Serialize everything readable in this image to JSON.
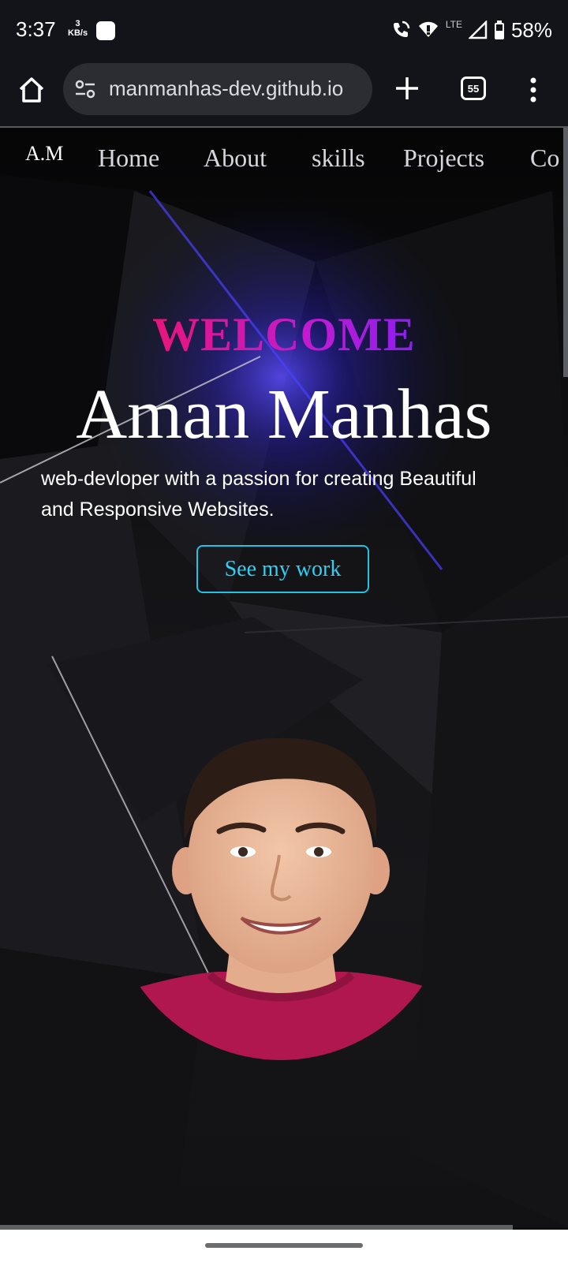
{
  "status_bar": {
    "time": "3:37",
    "net_speed_value": "3",
    "net_speed_unit": "KB/s",
    "battery": "58%",
    "network": "LTE",
    "icons": [
      "wifi-calling-icon",
      "wifi-icon",
      "signal-icon",
      "battery-icon"
    ]
  },
  "browser": {
    "url": "manmanhas-dev.github.io",
    "tab_count": "55",
    "icons": [
      "home-icon",
      "site-settings-icon",
      "new-tab-icon",
      "tabs-icon",
      "more-menu-icon"
    ]
  },
  "site": {
    "nav": {
      "logo": "A.M",
      "links": [
        "Home",
        "About",
        "skills",
        "Projects",
        "Co"
      ]
    },
    "hero": {
      "welcome": "WELCOME",
      "name": "Aman Manhas",
      "tagline_line1": "web-devloper with a passion for creating Beautiful",
      "tagline_line2": "and Responsive Websites.",
      "cta_label": "See my work"
    }
  },
  "colors": {
    "accent_cyan": "#22c2e6",
    "welcome_gradient_start": "#e8157a",
    "welcome_gradient_end": "#8b1ef0",
    "shirt": "#b0174f",
    "glow": "#3f35ff"
  }
}
